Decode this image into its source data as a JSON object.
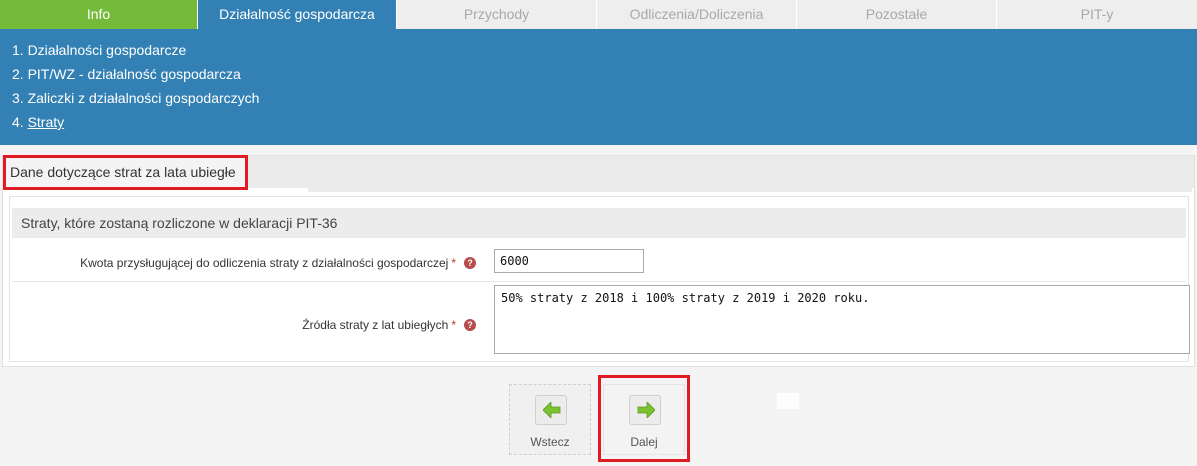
{
  "tabs": [
    {
      "label": "Info"
    },
    {
      "label": "Działalność gospodarcza"
    },
    {
      "label": "Przychody"
    },
    {
      "label": "Odliczenia/Doliczenia"
    },
    {
      "label": "Pozostałe"
    },
    {
      "label": "PIT-y"
    }
  ],
  "subnav": [
    {
      "label": "1. Działalności gospodarcze"
    },
    {
      "label": "2. PIT/WZ - działalność gospodarcza"
    },
    {
      "label": "3. Zaliczki z działalności gospodarczych"
    },
    {
      "num": "4.",
      "label": "Straty"
    }
  ],
  "section": {
    "title": "Dane dotyczące strat za lata ubiegłe",
    "subtitle": "Straty, które zostaną rozliczone w deklaracji PIT-36"
  },
  "fields": {
    "amount": {
      "label": "Kwota przysługującej do odliczenia straty z działalności gospodarczej",
      "required": "*",
      "value": "6000"
    },
    "sources": {
      "label": "Źródła straty z lat ubiegłych",
      "required": "*",
      "value": "50% straty z 2018 i 100% straty z 2019 i 2020 roku."
    },
    "help_glyph": "?"
  },
  "nav": {
    "back_label": "Wstecz",
    "next_label": "Dalej"
  },
  "colors": {
    "active_tab": "#3381b4",
    "info_tab": "#74bb3a",
    "highlight": "#e01b24",
    "arrow": "#7cc230"
  }
}
